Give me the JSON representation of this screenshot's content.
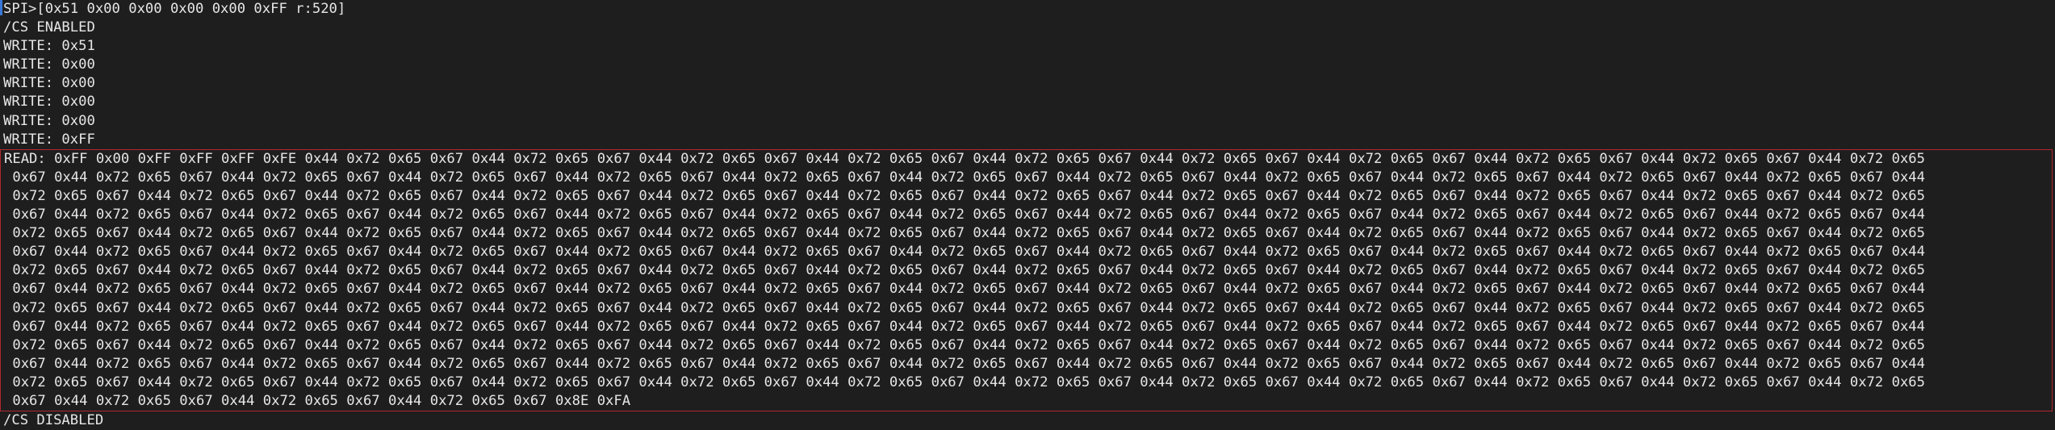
{
  "terminal": {
    "command": "SPI>[0x51 0x00 0x00 0x00 0x00 0xFF r:520]",
    "cs_enabled": "/CS ENABLED",
    "writes": [
      "WRITE: 0x51",
      "WRITE: 0x00",
      "WRITE: 0x00",
      "WRITE: 0x00",
      "WRITE: 0x00",
      "WRITE: 0xFF"
    ],
    "read_lines": [
      "READ: 0xFF 0x00 0xFF 0xFF 0xFF 0xFE 0x44 0x72 0x65 0x67 0x44 0x72 0x65 0x67 0x44 0x72 0x65 0x67 0x44 0x72 0x65 0x67 0x44 0x72 0x65 0x67 0x44 0x72 0x65 0x67 0x44 0x72 0x65 0x67 0x44 0x72 0x65 0x67 0x44 0x72 0x65 0x67 0x44 0x72 0x65",
      " 0x67 0x44 0x72 0x65 0x67 0x44 0x72 0x65 0x67 0x44 0x72 0x65 0x67 0x44 0x72 0x65 0x67 0x44 0x72 0x65 0x67 0x44 0x72 0x65 0x67 0x44 0x72 0x65 0x67 0x44 0x72 0x65 0x67 0x44 0x72 0x65 0x67 0x44 0x72 0x65 0x67 0x44 0x72 0x65 0x67 0x44",
      " 0x72 0x65 0x67 0x44 0x72 0x65 0x67 0x44 0x72 0x65 0x67 0x44 0x72 0x65 0x67 0x44 0x72 0x65 0x67 0x44 0x72 0x65 0x67 0x44 0x72 0x65 0x67 0x44 0x72 0x65 0x67 0x44 0x72 0x65 0x67 0x44 0x72 0x65 0x67 0x44 0x72 0x65 0x67 0x44 0x72 0x65",
      " 0x67 0x44 0x72 0x65 0x67 0x44 0x72 0x65 0x67 0x44 0x72 0x65 0x67 0x44 0x72 0x65 0x67 0x44 0x72 0x65 0x67 0x44 0x72 0x65 0x67 0x44 0x72 0x65 0x67 0x44 0x72 0x65 0x67 0x44 0x72 0x65 0x67 0x44 0x72 0x65 0x67 0x44 0x72 0x65 0x67 0x44",
      " 0x72 0x65 0x67 0x44 0x72 0x65 0x67 0x44 0x72 0x65 0x67 0x44 0x72 0x65 0x67 0x44 0x72 0x65 0x67 0x44 0x72 0x65 0x67 0x44 0x72 0x65 0x67 0x44 0x72 0x65 0x67 0x44 0x72 0x65 0x67 0x44 0x72 0x65 0x67 0x44 0x72 0x65 0x67 0x44 0x72 0x65",
      " 0x67 0x44 0x72 0x65 0x67 0x44 0x72 0x65 0x67 0x44 0x72 0x65 0x67 0x44 0x72 0x65 0x67 0x44 0x72 0x65 0x67 0x44 0x72 0x65 0x67 0x44 0x72 0x65 0x67 0x44 0x72 0x65 0x67 0x44 0x72 0x65 0x67 0x44 0x72 0x65 0x67 0x44 0x72 0x65 0x67 0x44",
      " 0x72 0x65 0x67 0x44 0x72 0x65 0x67 0x44 0x72 0x65 0x67 0x44 0x72 0x65 0x67 0x44 0x72 0x65 0x67 0x44 0x72 0x65 0x67 0x44 0x72 0x65 0x67 0x44 0x72 0x65 0x67 0x44 0x72 0x65 0x67 0x44 0x72 0x65 0x67 0x44 0x72 0x65 0x67 0x44 0x72 0x65",
      " 0x67 0x44 0x72 0x65 0x67 0x44 0x72 0x65 0x67 0x44 0x72 0x65 0x67 0x44 0x72 0x65 0x67 0x44 0x72 0x65 0x67 0x44 0x72 0x65 0x67 0x44 0x72 0x65 0x67 0x44 0x72 0x65 0x67 0x44 0x72 0x65 0x67 0x44 0x72 0x65 0x67 0x44 0x72 0x65 0x67 0x44",
      " 0x72 0x65 0x67 0x44 0x72 0x65 0x67 0x44 0x72 0x65 0x67 0x44 0x72 0x65 0x67 0x44 0x72 0x65 0x67 0x44 0x72 0x65 0x67 0x44 0x72 0x65 0x67 0x44 0x72 0x65 0x67 0x44 0x72 0x65 0x67 0x44 0x72 0x65 0x67 0x44 0x72 0x65 0x67 0x44 0x72 0x65",
      " 0x67 0x44 0x72 0x65 0x67 0x44 0x72 0x65 0x67 0x44 0x72 0x65 0x67 0x44 0x72 0x65 0x67 0x44 0x72 0x65 0x67 0x44 0x72 0x65 0x67 0x44 0x72 0x65 0x67 0x44 0x72 0x65 0x67 0x44 0x72 0x65 0x67 0x44 0x72 0x65 0x67 0x44 0x72 0x65 0x67 0x44",
      " 0x72 0x65 0x67 0x44 0x72 0x65 0x67 0x44 0x72 0x65 0x67 0x44 0x72 0x65 0x67 0x44 0x72 0x65 0x67 0x44 0x72 0x65 0x67 0x44 0x72 0x65 0x67 0x44 0x72 0x65 0x67 0x44 0x72 0x65 0x67 0x44 0x72 0x65 0x67 0x44 0x72 0x65 0x67 0x44 0x72 0x65",
      " 0x67 0x44 0x72 0x65 0x67 0x44 0x72 0x65 0x67 0x44 0x72 0x65 0x67 0x44 0x72 0x65 0x67 0x44 0x72 0x65 0x67 0x44 0x72 0x65 0x67 0x44 0x72 0x65 0x67 0x44 0x72 0x65 0x67 0x44 0x72 0x65 0x67 0x44 0x72 0x65 0x67 0x44 0x72 0x65 0x67 0x44",
      " 0x72 0x65 0x67 0x44 0x72 0x65 0x67 0x44 0x72 0x65 0x67 0x44 0x72 0x65 0x67 0x44 0x72 0x65 0x67 0x44 0x72 0x65 0x67 0x44 0x72 0x65 0x67 0x44 0x72 0x65 0x67 0x44 0x72 0x65 0x67 0x44 0x72 0x65 0x67 0x44 0x72 0x65 0x67 0x44 0x72 0x65",
      " 0x67 0x44 0x72 0x65 0x67 0x44 0x72 0x65 0x67 0x44 0x72 0x65 0x67 0x8E 0xFA"
    ],
    "cs_disabled": "/CS DISABLED"
  },
  "colors": {
    "background": "#1e1e1e",
    "text": "#e6e6e6",
    "cursor": "#3a78d8",
    "highlight_border": "#b0282e"
  }
}
